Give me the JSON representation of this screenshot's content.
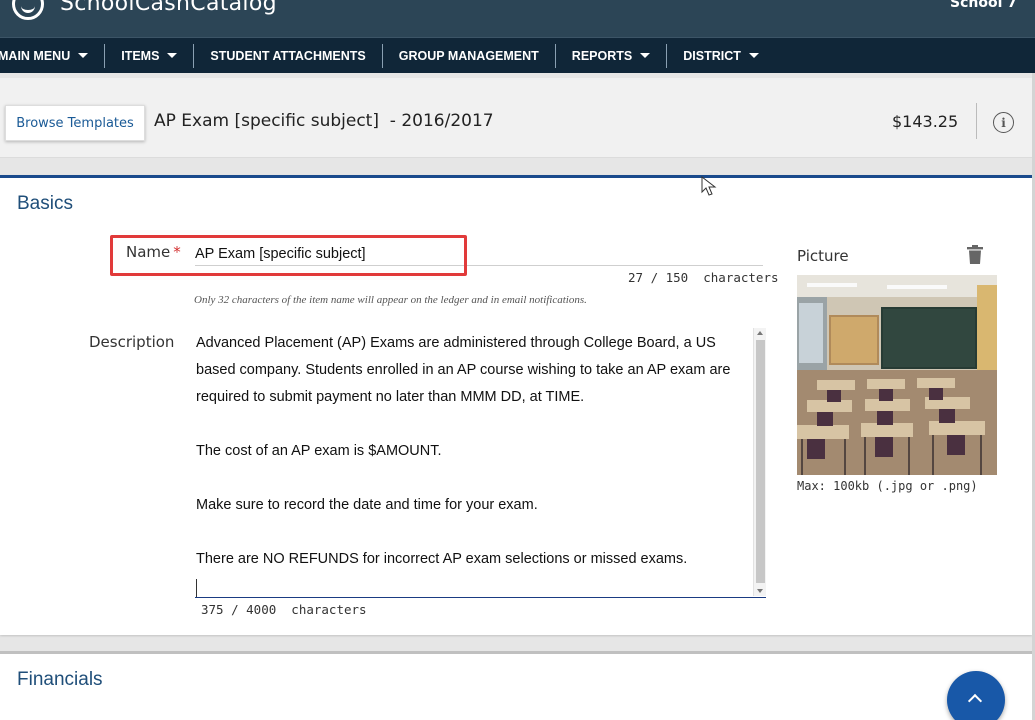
{
  "header": {
    "app_title": "SchoolCashCatalog",
    "school": "School 7"
  },
  "nav": {
    "items": [
      {
        "label": "MAIN MENU",
        "has_dropdown": true
      },
      {
        "label": "ITEMS",
        "has_dropdown": true
      },
      {
        "label": "STUDENT ATTACHMENTS",
        "has_dropdown": false
      },
      {
        "label": "GROUP MANAGEMENT",
        "has_dropdown": false
      },
      {
        "label": "REPORTS",
        "has_dropdown": true
      },
      {
        "label": "DISTRICT",
        "has_dropdown": true
      }
    ]
  },
  "titlebar": {
    "browse_button": "Browse Templates",
    "item_title": "AP Exam [specific subject]  - 2016/2017",
    "price": "$143.25"
  },
  "basics": {
    "heading": "Basics",
    "name_label": "Name",
    "required_mark": "*",
    "name_value": "AP Exam [specific subject]",
    "name_counter": "27 / 150  characters",
    "name_hint": "Only 32 characters of the item name will appear on the ledger and in email notifications.",
    "description_label": "Description",
    "description_paragraphs": [
      "Advanced Placement (AP) Exams are administered through College Board, a US based company. Students enrolled in an AP course wishing to take an AP exam are required to submit payment no later than MMM DD, at TIME.",
      "The cost of an AP exam is $AMOUNT.",
      "Make sure to record the date and time for your exam.",
      "There are NO REFUNDS for incorrect AP exam selections or missed exams."
    ],
    "description_counter": "375 / 4000  characters",
    "picture_label": "Picture",
    "picture_hint": "Max: 100kb (.jpg or .png)"
  },
  "financials": {
    "heading": "Financials"
  },
  "colors": {
    "header_bg": "#2c4556",
    "nav_bg": "#102638",
    "accent": "#1a4a8c",
    "heading": "#1f4e79",
    "highlight": "#e13a3a",
    "fab": "#1858a8"
  },
  "icons": [
    "logo-icon",
    "caret-down-icon",
    "info-icon",
    "trash-icon",
    "chevron-up-icon",
    "mouse-cursor-icon"
  ]
}
